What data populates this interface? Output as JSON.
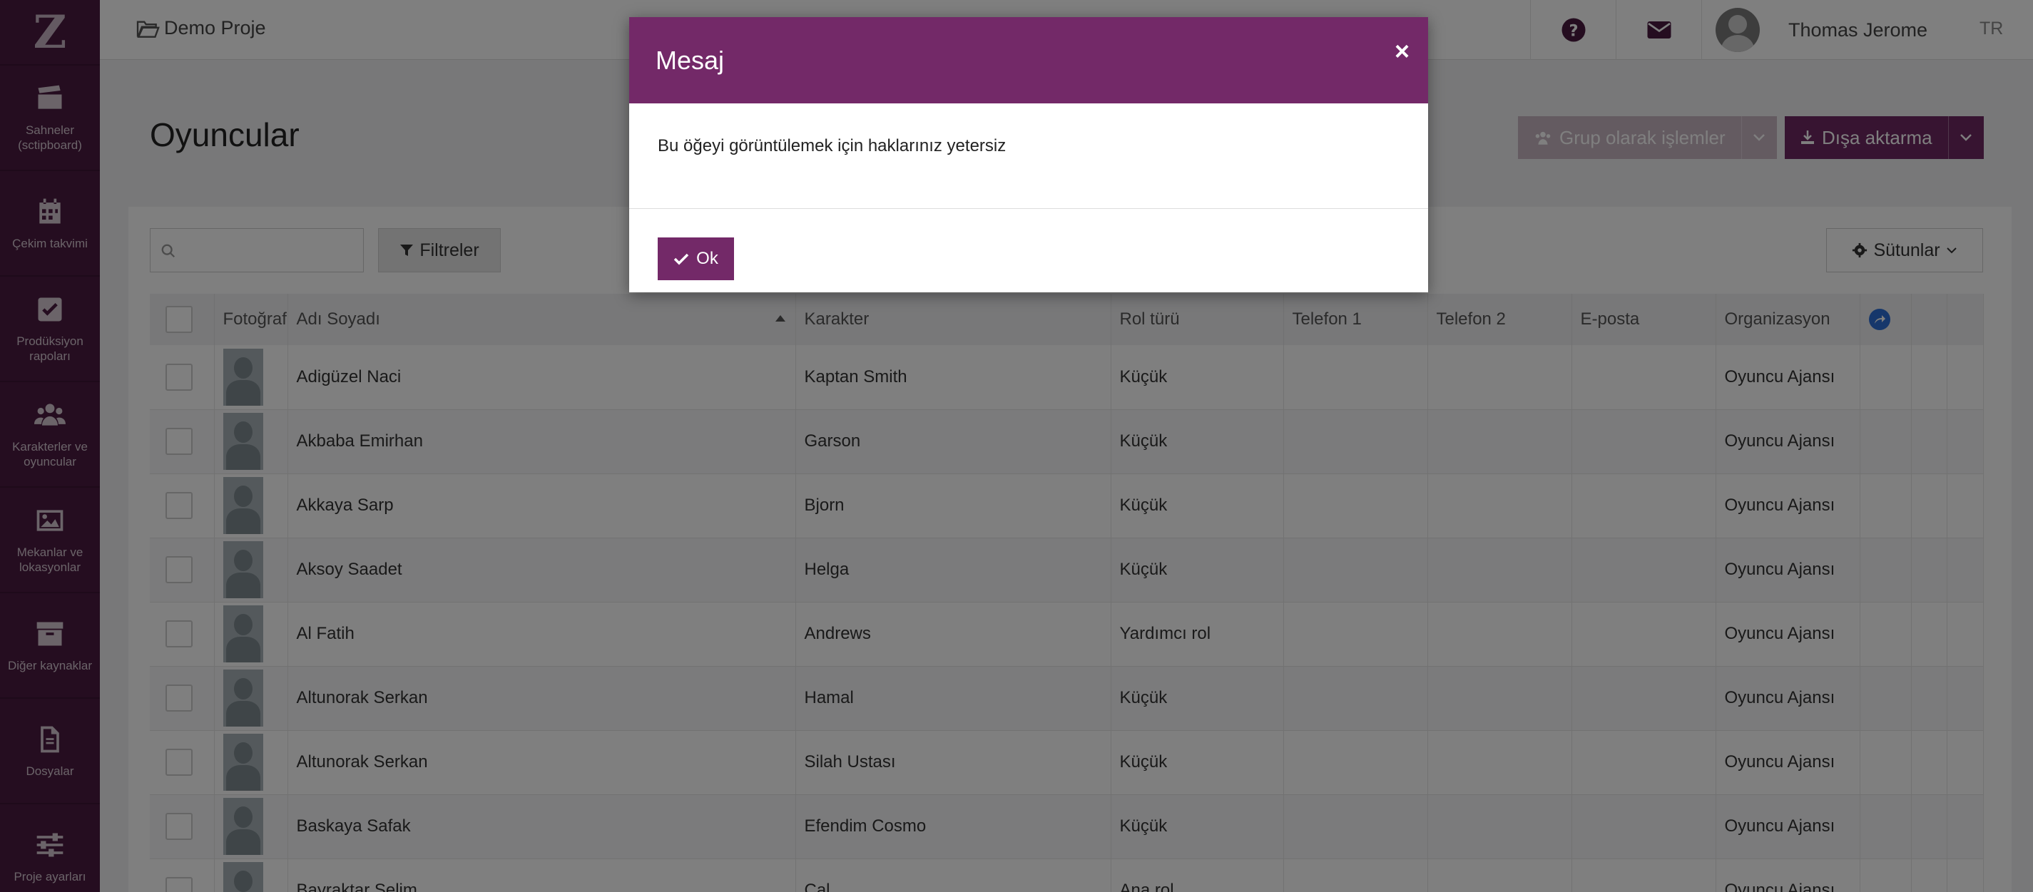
{
  "sidebar": {
    "logo": "Z",
    "items": [
      {
        "label": "Sahneler (sctipboard)",
        "icon": "clapperboard-icon"
      },
      {
        "label": "Çekim takvimi",
        "icon": "calendar-icon"
      },
      {
        "label": "Prodüksiyon rapoları",
        "icon": "check-square-icon"
      },
      {
        "label": "Karakterler ve oyuncular",
        "icon": "users-icon"
      },
      {
        "label": "Mekanlar ve lokasyonlar",
        "icon": "image-icon"
      },
      {
        "label": "Diğer kaynaklar",
        "icon": "archive-icon"
      },
      {
        "label": "Dosyalar",
        "icon": "file-icon"
      },
      {
        "label": "Proje ayarları",
        "icon": "sliders-icon"
      }
    ]
  },
  "topbar": {
    "project_name": "Demo Proje",
    "user_name": "Thomas Jerome",
    "language": "TR",
    "help_icon": "question-circle-icon",
    "mail_icon": "envelope-icon"
  },
  "page": {
    "title": "Oyuncular",
    "group_actions_label": "Grup olarak işlemler",
    "export_label": "Dışa aktarma",
    "filters_label": "Filtreler",
    "columns_label": "Sütunlar",
    "search_placeholder": ""
  },
  "table": {
    "headers": [
      "",
      "Fotoğraf",
      "Adı Soyadı",
      "Karakter",
      "Rol türü",
      "Telefon 1",
      "Telefon 2",
      "E-posta",
      "Organizasyon",
      "",
      "",
      ""
    ],
    "rows": [
      {
        "name": "Adigüzel Naci",
        "character": "Kaptan Smith",
        "role": "Küçük",
        "org": "Oyuncu Ajansı"
      },
      {
        "name": "Akbaba Emirhan",
        "character": "Garson",
        "role": "Küçük",
        "org": "Oyuncu Ajansı"
      },
      {
        "name": "Akkaya Sarp",
        "character": "Bjorn",
        "role": "Küçük",
        "org": "Oyuncu Ajansı"
      },
      {
        "name": "Aksoy Saadet",
        "character": "Helga",
        "role": "Küçük",
        "org": "Oyuncu Ajansı"
      },
      {
        "name": "Al Fatih",
        "character": "Andrews",
        "role": "Yardımcı rol",
        "org": "Oyuncu Ajansı"
      },
      {
        "name": "Altunorak Serkan",
        "character": "Hamal",
        "role": "Küçük",
        "org": "Oyuncu Ajansı"
      },
      {
        "name": "Altunorak Serkan",
        "character": "Silah Ustası",
        "role": "Küçük",
        "org": "Oyuncu Ajansı"
      },
      {
        "name": "Baskaya Safak",
        "character": "Efendim Cosmo",
        "role": "Küçük",
        "org": "Oyuncu Ajansı"
      },
      {
        "name": "Bayraktar Selim",
        "character": "Cal",
        "role": "Ana rol",
        "org": "Oyuncu Ajansı"
      }
    ]
  },
  "modal": {
    "title": "Mesaj",
    "close": "×",
    "message": "Bu öğeyi görüntülemek için haklarınız yetersiz",
    "ok_label": "Ok"
  },
  "colors": {
    "sidebar_bg": "#4a1a40",
    "accent": "#732968",
    "overlay": "rgba(0,0,0,0.5)"
  }
}
